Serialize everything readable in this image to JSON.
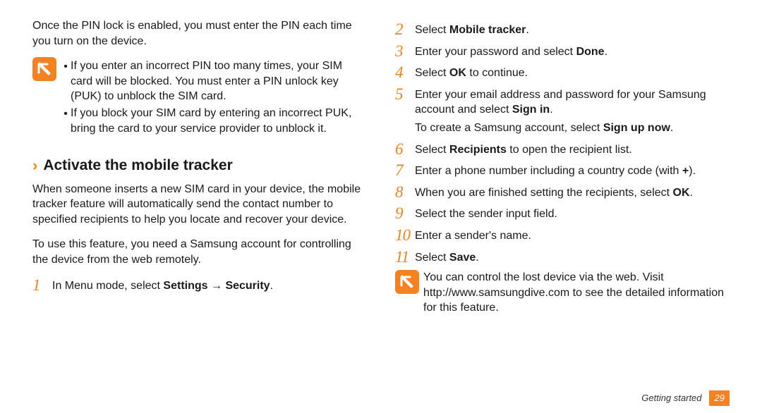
{
  "left": {
    "intro": "Once the PIN lock is enabled, you must enter the PIN each time you turn on the device.",
    "note": {
      "bullets": [
        "If you enter an incorrect PIN too many times, your SIM card will be blocked. You must enter a PIN unlock key (PUK) to unblock the SIM card.",
        "If you block your SIM card by entering an incorrect PUK, bring the card to your service provider to unblock it."
      ]
    },
    "heading": "Activate the mobile tracker",
    "p1": "When someone inserts a new SIM card in your device, the mobile tracker feature will automatically send the contact number to specified recipients to help you locate and recover your device.",
    "p2": "To use this feature, you need a Samsung account for controlling the device from the web remotely.",
    "step1_num": "1",
    "step1_a": "In Menu mode, select ",
    "step1_b": "Settings",
    "step1_arrow": " → ",
    "step1_c": "Security",
    "step1_d": "."
  },
  "right": {
    "s2_num": "2",
    "s2_a": "Select ",
    "s2_b": "Mobile tracker",
    "s2_c": ".",
    "s3_num": "3",
    "s3_a": "Enter your password and select ",
    "s3_b": "Done",
    "s3_c": ".",
    "s4_num": "4",
    "s4_a": "Select ",
    "s4_b": "OK",
    "s4_c": " to continue.",
    "s5_num": "5",
    "s5_line1_a": "Enter your email address and password for your Samsung account and select ",
    "s5_line1_b": "Sign in",
    "s5_line1_c": ".",
    "s5_line2_a": "To create a Samsung account, select ",
    "s5_line2_b": "Sign up now",
    "s5_line2_c": ".",
    "s6_num": "6",
    "s6_a": "Select ",
    "s6_b": "Recipients",
    "s6_c": " to open the recipient list.",
    "s7_num": "7",
    "s7_a": "Enter a phone number including a country code (with ",
    "s7_b": "+",
    "s7_c": ").",
    "s8_num": "8",
    "s8_a": "When you are finished setting the recipients, select ",
    "s8_b": "OK",
    "s8_c": ".",
    "s9_num": "9",
    "s9": "Select the sender input field.",
    "s10_num": "10",
    "s10": "Enter a sender's name.",
    "s11_num": "11",
    "s11_a": "Select ",
    "s11_b": "Save",
    "s11_c": ".",
    "note_text": "You can control the lost device via the web. Visit http://www.samsungdive.com to see the detailed information for this feature."
  },
  "footer": {
    "section": "Getting started",
    "page": "29"
  },
  "glyphs": {
    "bullet": "•"
  }
}
